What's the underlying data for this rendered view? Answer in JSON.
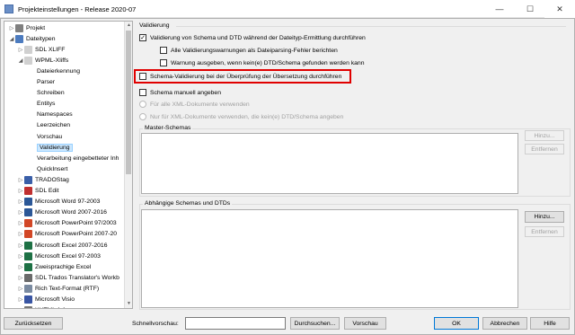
{
  "window": {
    "title": "Projekteinstellungen - Release 2020-07",
    "minimize": "—",
    "maximize": "☐",
    "close": "✕"
  },
  "tree": {
    "items": [
      {
        "label": "Projekt",
        "expander": "▷",
        "icon": "project-icon",
        "color": "#808080"
      },
      {
        "label": "Dateitypen",
        "expander": "◢",
        "icon": "filetypes-icon",
        "color": "#4c7bbf"
      },
      {
        "label": "SDL XLIFF",
        "expander": "▷",
        "icon": "document-icon",
        "color": "#d0d0d0"
      },
      {
        "label": "WPML-Xliffs",
        "expander": "◢",
        "icon": "document-icon",
        "color": "#d0d0d0"
      },
      {
        "label": "Dateierkennung"
      },
      {
        "label": "Parser"
      },
      {
        "label": "Schreiben"
      },
      {
        "label": "Entitys"
      },
      {
        "label": "Namespaces"
      },
      {
        "label": "Leerzeichen"
      },
      {
        "label": "Vorschau"
      },
      {
        "label": "Validierung"
      },
      {
        "label": "Verarbeitung eingebetteter Inh"
      },
      {
        "label": "QuickInsert"
      },
      {
        "label": "TRADOStag",
        "expander": "▷",
        "icon": "tradostag-icon",
        "color": "#3a5fa8"
      },
      {
        "label": "SDL Edit",
        "expander": "▷",
        "icon": "sdl-edit-icon",
        "color": "#c03030"
      },
      {
        "label": "Microsoft Word 97-2003",
        "expander": "▷",
        "icon": "word-icon",
        "color": "#2b5797"
      },
      {
        "label": "Microsoft Word 2007-2016",
        "expander": "▷",
        "icon": "word-icon",
        "color": "#2b5797"
      },
      {
        "label": "Microsoft PowerPoint 97/2003",
        "expander": "▷",
        "icon": "powerpoint-icon",
        "color": "#d24726"
      },
      {
        "label": "Microsoft PowerPoint 2007-20",
        "expander": "▷",
        "icon": "powerpoint-icon",
        "color": "#d24726"
      },
      {
        "label": "Microsoft Excel 2007-2016",
        "expander": "▷",
        "icon": "excel-icon",
        "color": "#1e7145"
      },
      {
        "label": "Microsoft Excel 97-2003",
        "expander": "▷",
        "icon": "excel-icon",
        "color": "#1e7145"
      },
      {
        "label": "Zweisprachige Excel",
        "expander": "▷",
        "icon": "excel-icon",
        "color": "#1e7145"
      },
      {
        "label": "SDL Trados Translator's Workb",
        "expander": "▷",
        "icon": "trados-icon",
        "color": "#6a6a6a"
      },
      {
        "label": "Rich Text-Format (RTF)",
        "expander": "▷",
        "icon": "rtf-icon",
        "color": "#7a8aa0"
      },
      {
        "label": "Microsoft Visio",
        "expander": "▷",
        "icon": "visio-icon",
        "color": "#3955a3"
      },
      {
        "label": "XHTML 1.1",
        "expander": "▷",
        "icon": "xhtml-icon",
        "color": "#777777"
      }
    ],
    "selected_label": "Validierung"
  },
  "validation": {
    "section_title": "Validierung",
    "main_check": {
      "label": "Validierung von Schema und DTD während der Dateityp-Ermittlung durchführen",
      "checked": "✓"
    },
    "sub_check_1": {
      "label": "Alle Validierungswarnungen als Dateiparsing-Fehler berichten"
    },
    "sub_check_2": {
      "label": "Warnung ausgeben, wenn kein(e) DTD/Schema gefunden werden kann"
    },
    "schema_check": {
      "label": "Schema-Validierung bei der Überprüfung der Übersetzung durchführen"
    },
    "manual_check": {
      "label": "Schema manuell angeben"
    },
    "radio_1": "Für alle XML-Dokumente verwenden",
    "radio_2": "Nur für XML-Dokumente verwenden, die kein(e) DTD/Schema angeben",
    "highlight_color": "#e00000"
  },
  "master_schemas": {
    "title": "Master-Schemas",
    "add_button": "Hinzu...",
    "remove_button": "Entfernen"
  },
  "dependent_schemas": {
    "title": "Abhängige Schemas und DTDs",
    "add_button": "Hinzu...",
    "remove_button": "Entfernen"
  },
  "footer": {
    "reset_button": "Zurücksetzen",
    "quickpreview_label": "Schnellvorschau:",
    "quickpreview_value": "",
    "search_button": "Durchsuchen...",
    "preview_button": "Vorschau",
    "ok_button": "OK",
    "cancel_button": "Abbrechen",
    "help_button": "Hilfe"
  }
}
